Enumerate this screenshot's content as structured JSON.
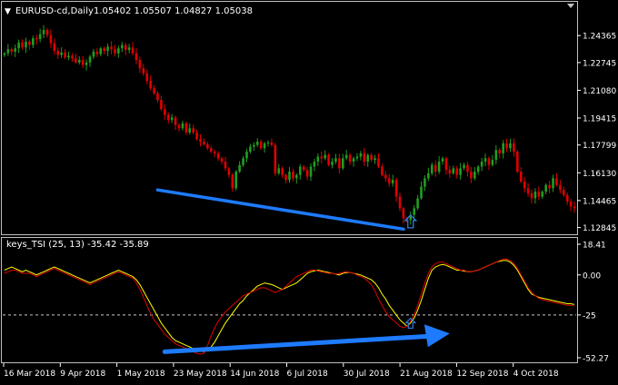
{
  "main_panel": {
    "header": {
      "arrow_glyph": "▼",
      "symbol_label": "EURUSD-cd,Daily",
      "ohlc": "1.05402 1.05507 1.04827 1.05038"
    },
    "price_scale_labels": [
      "1.24365",
      "1.22745",
      "1.21080",
      "1.19415",
      "1.17799",
      "1.16130",
      "1.14465",
      "1.12845"
    ],
    "price_scale_values": [
      1.24365,
      1.22745,
      1.2108,
      1.19415,
      1.17799,
      1.1613,
      1.14465,
      1.12845
    ],
    "signal_arrow_icon": "up-arrow-icon"
  },
  "indicator_panel": {
    "header": {
      "label": "keys_TSI (25, 13) -35.42 -35.89"
    },
    "scale_labels": [
      "18.41",
      "0.00",
      "-25",
      "-52.27"
    ],
    "scale_values": [
      18.41,
      0,
      -25,
      -52.27
    ],
    "signal_arrow_icon": "up-arrow-icon"
  },
  "time_axis": {
    "labels": [
      "16 Mar 2018",
      "9 Apr 2018",
      "1 May 2018",
      "23 May 2018",
      "14 Jun 2018",
      "6 Jul 2018",
      "30 Jul 2018",
      "21 Aug 2018",
      "12 Sep 2018",
      "4 Oct 2018"
    ]
  },
  "colors": {
    "background": "#000000",
    "bull_candle": "#1f9e1f",
    "bear_candle": "#e00000",
    "grid_text": "#ffffff",
    "trend_arrow": "#1e7bff",
    "tsi_line": "#ffff00",
    "signal_line": "#e00000",
    "level_line": "#c8c8c8",
    "signal_arrow": "#2f7bd8"
  },
  "chart_data": [
    {
      "type": "candlestick",
      "title": "EURUSD-cd,Daily",
      "ylim": [
        1.1255,
        1.253
      ],
      "series": [
        {
          "name": "EURUSD-cd",
          "close": [
            1.233,
            1.2355,
            1.234,
            1.236,
            1.2395,
            1.2365,
            1.24,
            1.238,
            1.242,
            1.2415,
            1.2445,
            1.247,
            1.244,
            1.239,
            1.2345,
            1.232,
            1.2335,
            1.2305,
            1.2315,
            1.23,
            1.2275,
            1.229,
            1.226,
            1.2275,
            1.231,
            1.234,
            1.2325,
            1.236,
            1.2345,
            1.237,
            1.2355,
            1.233,
            1.236,
            1.238,
            1.235,
            1.2365,
            1.233,
            1.229,
            1.224,
            1.221,
            1.2165,
            1.212,
            1.209,
            1.205,
            1.1995,
            1.196,
            1.193,
            1.1945,
            1.19,
            1.188,
            1.191,
            1.1855,
            1.188,
            1.1855,
            1.1815,
            1.18,
            1.1785,
            1.176,
            1.174,
            1.173,
            1.17,
            1.168,
            1.164,
            1.16,
            1.152,
            1.162,
            1.166,
            1.17,
            1.174,
            1.177,
            1.178,
            1.18,
            1.176,
            1.179,
            1.1795,
            1.178,
            1.161,
            1.164,
            1.16,
            1.157,
            1.162,
            1.158,
            1.16,
            1.165,
            1.163,
            1.159,
            1.165,
            1.168,
            1.171,
            1.17,
            1.172,
            1.166,
            1.168,
            1.17,
            1.164,
            1.17,
            1.172,
            1.168,
            1.17,
            1.171,
            1.173,
            1.168,
            1.172,
            1.169,
            1.17,
            1.165,
            1.16,
            1.158,
            1.155,
            1.157,
            1.147,
            1.14,
            1.134,
            1.133,
            1.136,
            1.14,
            1.146,
            1.153,
            1.158,
            1.161,
            1.166,
            1.162,
            1.168,
            1.17,
            1.163,
            1.161,
            1.164,
            1.16,
            1.164,
            1.166,
            1.162,
            1.158,
            1.162,
            1.165,
            1.168,
            1.17,
            1.166,
            1.169,
            1.175,
            1.173,
            1.179,
            1.176,
            1.179,
            1.174,
            1.162,
            1.156,
            1.152,
            1.149,
            1.146,
            1.15,
            1.147,
            1.15,
            1.154,
            1.152,
            1.158,
            1.154,
            1.151,
            1.148,
            1.144,
            1.141,
            1.14
          ]
        }
      ],
      "annotations": [
        {
          "type": "trend-arrow",
          "from_index": 43,
          "from_price": 1.151,
          "to_index": 112,
          "to_price": 1.1275
        },
        {
          "type": "signal-arrow-up",
          "index": 114,
          "price": 1.131
        }
      ]
    },
    {
      "type": "line",
      "title": "keys_TSI (25, 13) -35.42 -35.89",
      "ylim": [
        -54,
        22
      ],
      "levels": [
        0,
        -25
      ],
      "series": [
        {
          "name": "TSI",
          "values": [
            3,
            4,
            5,
            4,
            3,
            2,
            3,
            2,
            1,
            0,
            1,
            2,
            3,
            4,
            5,
            4,
            3,
            2,
            1,
            0,
            -1,
            -2,
            -3,
            -4,
            -5,
            -4,
            -3,
            -2,
            -1,
            0,
            1,
            2,
            3,
            2,
            1,
            0,
            -1,
            -3,
            -6,
            -10,
            -14,
            -18,
            -22,
            -26,
            -30,
            -33,
            -36,
            -39,
            -41,
            -42,
            -43,
            -44,
            -45,
            -46,
            -47,
            -47.5,
            -48,
            -47,
            -45,
            -42,
            -38,
            -34,
            -30,
            -27,
            -24,
            -21,
            -18,
            -16,
            -13,
            -11,
            -9,
            -7,
            -6,
            -5,
            -5.5,
            -6,
            -7,
            -8,
            -9,
            -8,
            -7,
            -6,
            -5,
            -3,
            -1,
            1,
            2,
            2.5,
            3,
            2.5,
            2,
            1.5,
            1,
            0.5,
            0,
            1,
            1.5,
            1.5,
            1,
            0.5,
            0,
            -1,
            -2,
            -3,
            -5,
            -8,
            -12,
            -15,
            -19,
            -22,
            -25,
            -28,
            -30,
            -32,
            -30,
            -27,
            -22,
            -16,
            -9,
            -2,
            3,
            5,
            6,
            6.5,
            6,
            5,
            4,
            3,
            3,
            2.5,
            2,
            2,
            2.5,
            3,
            4,
            5,
            6,
            7,
            8,
            8.5,
            9,
            9,
            8,
            6,
            3,
            -1,
            -5,
            -9,
            -12,
            -13,
            -14,
            -14.5,
            -15,
            -15.5,
            -16,
            -16.5,
            -17,
            -17.5,
            -18,
            -18,
            -18.5
          ]
        },
        {
          "name": "Signal",
          "values": [
            1,
            2,
            3,
            3,
            2,
            1,
            1,
            1,
            0,
            -1,
            0,
            1,
            2,
            3,
            4,
            3,
            2,
            1,
            0,
            -1,
            -2,
            -3,
            -4,
            -5,
            -6,
            -5,
            -4,
            -3,
            -2,
            -1,
            0,
            1,
            2,
            1,
            0,
            -1,
            -2,
            -5,
            -9,
            -14,
            -19,
            -24,
            -28,
            -31,
            -34,
            -37,
            -39,
            -41,
            -43,
            -44,
            -45,
            -46,
            -47,
            -48,
            -49,
            -49.5,
            -49,
            -44,
            -38,
            -33,
            -29,
            -26,
            -23,
            -21,
            -19,
            -17,
            -15,
            -13,
            -12,
            -11,
            -10,
            -9,
            -8,
            -8,
            -9,
            -10,
            -11,
            -10,
            -9,
            -7,
            -5,
            -3,
            -1,
            0,
            1,
            2,
            3,
            3,
            2.5,
            2,
            1.5,
            1,
            1,
            0.5,
            1,
            1.5,
            2,
            1.5,
            1,
            0,
            -1,
            -2,
            -4,
            -6,
            -10,
            -15,
            -19,
            -23,
            -26,
            -28,
            -30,
            -32,
            -33,
            -32,
            -29,
            -25,
            -19,
            -12,
            -5,
            1,
            5,
            7,
            8,
            8,
            7,
            6,
            5,
            4,
            3,
            3,
            2,
            2,
            2.5,
            3,
            4,
            5,
            6,
            7,
            8,
            9,
            10,
            10,
            9,
            7,
            4,
            0,
            -4,
            -8,
            -11,
            -13,
            -14.5,
            -15.5,
            -16,
            -16.5,
            -17,
            -17.5,
            -18,
            -18.5,
            -19,
            -19,
            -19.5
          ]
        }
      ],
      "annotations": [
        {
          "type": "trend-arrow",
          "from_index": 45,
          "from_value": -48,
          "to_index": 125,
          "to_value": -36
        },
        {
          "type": "signal-arrow-up",
          "index": 114,
          "value": -31
        }
      ]
    }
  ]
}
